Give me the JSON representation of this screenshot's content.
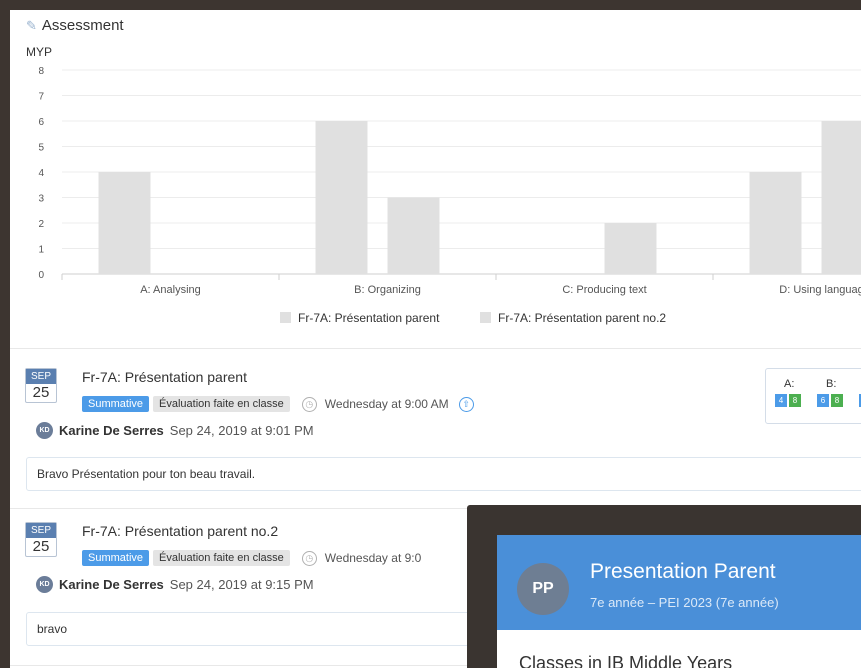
{
  "section": {
    "title": "Assessment",
    "icon": "edit-icon"
  },
  "chart_data": {
    "type": "bar",
    "ylabel": "MYP",
    "ylim": [
      0,
      8
    ],
    "yticks": [
      0,
      1,
      2,
      3,
      4,
      5,
      6,
      7,
      8
    ],
    "categories": [
      "A: Analysing",
      "B: Organizing",
      "C: Producing text",
      "D: Using languag"
    ],
    "series": [
      {
        "name": "Fr-7A: Présentation parent",
        "values": [
          4,
          6,
          0,
          4
        ]
      },
      {
        "name": "Fr-7A: Présentation parent no.2",
        "values": [
          0,
          3,
          2,
          6
        ]
      }
    ],
    "bar_color": "#e0e0e0",
    "legend_position": "bottom",
    "grid": true
  },
  "entries": [
    {
      "month": "SEP",
      "day": "25",
      "title": "Fr-7A: Présentation parent",
      "tag_type": "Summative",
      "tag_mode": "Évaluation faite en classe",
      "when": "Wednesday at 9:00 AM",
      "author_initials": "KD",
      "author": "Karine De Serres",
      "posted": "Sep 24, 2019 at 9:01 PM",
      "comment": "Bravo Présentation pour ton beau travail.",
      "scores": [
        {
          "label": "A:",
          "value": "4",
          "max": "8"
        },
        {
          "label": "B:",
          "value": "6",
          "max": "8"
        }
      ]
    },
    {
      "month": "SEP",
      "day": "25",
      "title": "Fr-7A: Présentation parent no.2",
      "tag_type": "Summative",
      "tag_mode": "Évaluation faite en classe",
      "when": "Wednesday at 9:0",
      "author_initials": "KD",
      "author": "Karine De Serres",
      "posted": "Sep 24, 2019 at 9:15 PM",
      "comment": "bravo"
    }
  ],
  "popup": {
    "initials": "PP",
    "name": "Presentation Parent",
    "subtitle": "7e année – PEI 2023 (7e année)",
    "classes_heading": "Classes in IB Middle Years"
  },
  "colors": {
    "accent": "#4c9be8",
    "score_green": "#4caf50",
    "popup_header": "#4a8fd8"
  }
}
